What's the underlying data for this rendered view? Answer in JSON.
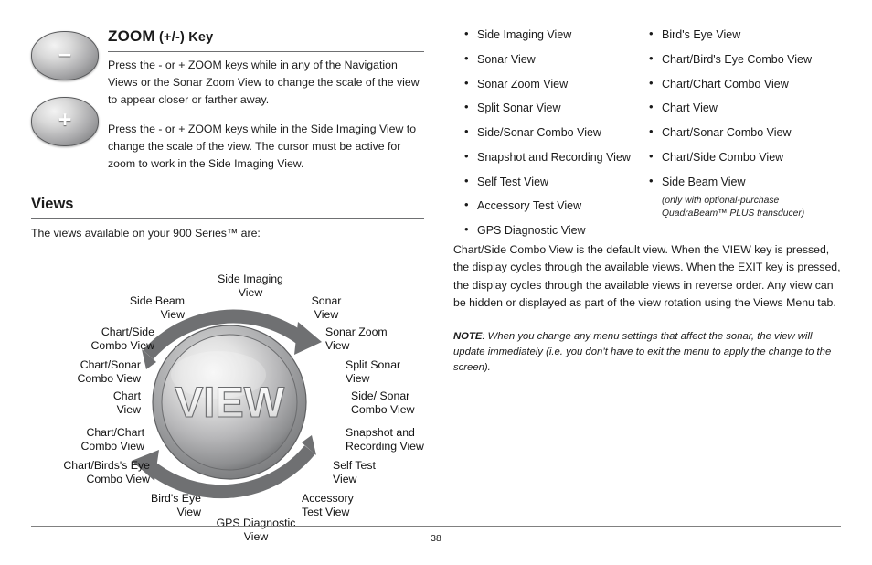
{
  "zoom_section": {
    "title_main": "ZOOM",
    "title_suffix": " (+/-) Key",
    "minus_glyph": "–",
    "plus_glyph": "+",
    "paragraph_1": "Press the - or + ZOOM keys while in any of the Navigation Views or the Sonar Zoom View to change the scale of the view to appear closer or farther away.",
    "paragraph_2": "Press the - or + ZOOM keys while in the Side Imaging View to change the scale of the view.  The cursor must be active for zoom to work in the Side Imaging View."
  },
  "views_section": {
    "heading": "Views",
    "intro": "The views available on your 900 Series™ are:"
  },
  "wheel": {
    "center_label": "VIEW",
    "labels": [
      {
        "text": "Side Imaging\nView",
        "align": "center"
      },
      {
        "text": "Sonar\nView",
        "align": "center"
      },
      {
        "text": "Side Beam\nView",
        "align": "right"
      },
      {
        "text": "Sonar Zoom\nView",
        "align": "left"
      },
      {
        "text": "Chart/Side\nCombo View",
        "align": "right"
      },
      {
        "text": "Split Sonar\nView",
        "align": "left"
      },
      {
        "text": "Chart/Sonar\nCombo View",
        "align": "right"
      },
      {
        "text": "Side/ Sonar\nCombo View",
        "align": "left"
      },
      {
        "text": "Chart\nView",
        "align": "right"
      },
      {
        "text": "Snapshot and\nRecording View",
        "align": "left"
      },
      {
        "text": "Chart/Chart\nCombo View",
        "align": "right"
      },
      {
        "text": "Self Test\nView",
        "align": "left"
      },
      {
        "text": "Chart/Birds's Eye\nCombo View",
        "align": "right"
      },
      {
        "text": "Accessory\nTest View",
        "align": "left"
      },
      {
        "text": "Bird's Eye\nView",
        "align": "right"
      },
      {
        "text": "GPS Diagnostic\nView",
        "align": "center"
      }
    ]
  },
  "views_list": {
    "column_1": [
      "Side Imaging View",
      "Sonar View",
      "Sonar Zoom View",
      "Split Sonar View",
      "Side/Sonar Combo View",
      "Snapshot and Recording View",
      "Self Test View",
      "Accessory Test View",
      "GPS Diagnostic View"
    ],
    "column_2": [
      "Bird's Eye View",
      "Chart/Bird's Eye Combo View",
      "Chart/Chart Combo View",
      "Chart View",
      "Chart/Sonar Combo View",
      "Chart/Side Combo View",
      "Side Beam View"
    ],
    "column_2_note": "(only with optional-purchase QuadraBeam™ PLUS transducer)"
  },
  "right_text": {
    "paragraph": "Chart/Side Combo View is the default view. When the VIEW key is pressed, the display cycles through the available views. When the EXIT key is pressed, the display cycles through the available views in reverse order. Any view can be hidden or displayed as part of the view rotation using the Views Menu tab.",
    "note_label": "NOTE",
    "note_text": ": When you change any menu settings that affect the sonar, the view will update immediately (i.e. you don’t have to exit the menu to apply the change to the screen)."
  },
  "footer": {
    "page_number": "38"
  }
}
